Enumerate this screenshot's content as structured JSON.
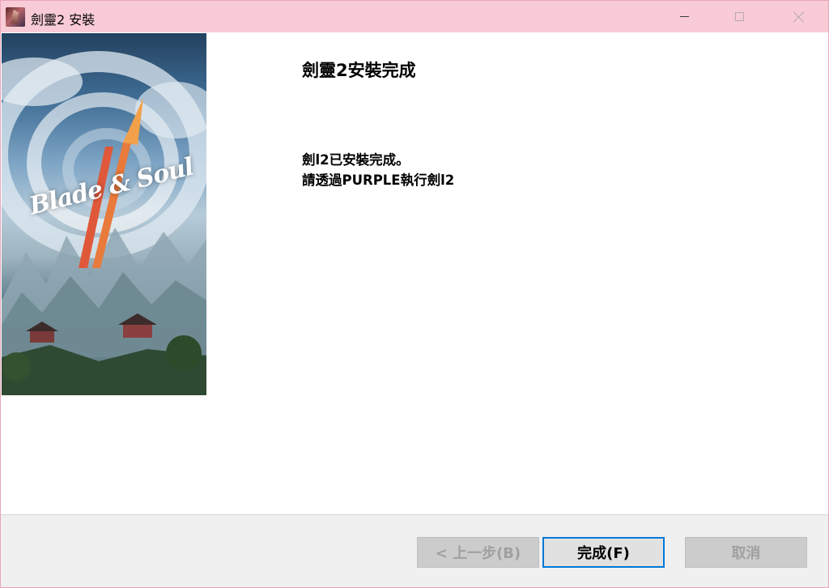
{
  "window": {
    "title": "劍靈2 安裝",
    "icon": "app-icon"
  },
  "banner": {
    "logo_text": "Blade & Soul",
    "logo_numeral": "II"
  },
  "content": {
    "title": "劍靈2安裝完成",
    "message_line_1": "劍l2已安裝完成。",
    "message_line_2": "請透過PURPLE執行劍l2"
  },
  "buttons": {
    "back": "< 上一步(B)",
    "finish": "完成(F)",
    "cancel": "取消"
  },
  "colors": {
    "titlebar": "#f8cbd7",
    "border": "#e9a5b9",
    "accent": "#0078d7",
    "footer": "#f0f0f0"
  }
}
